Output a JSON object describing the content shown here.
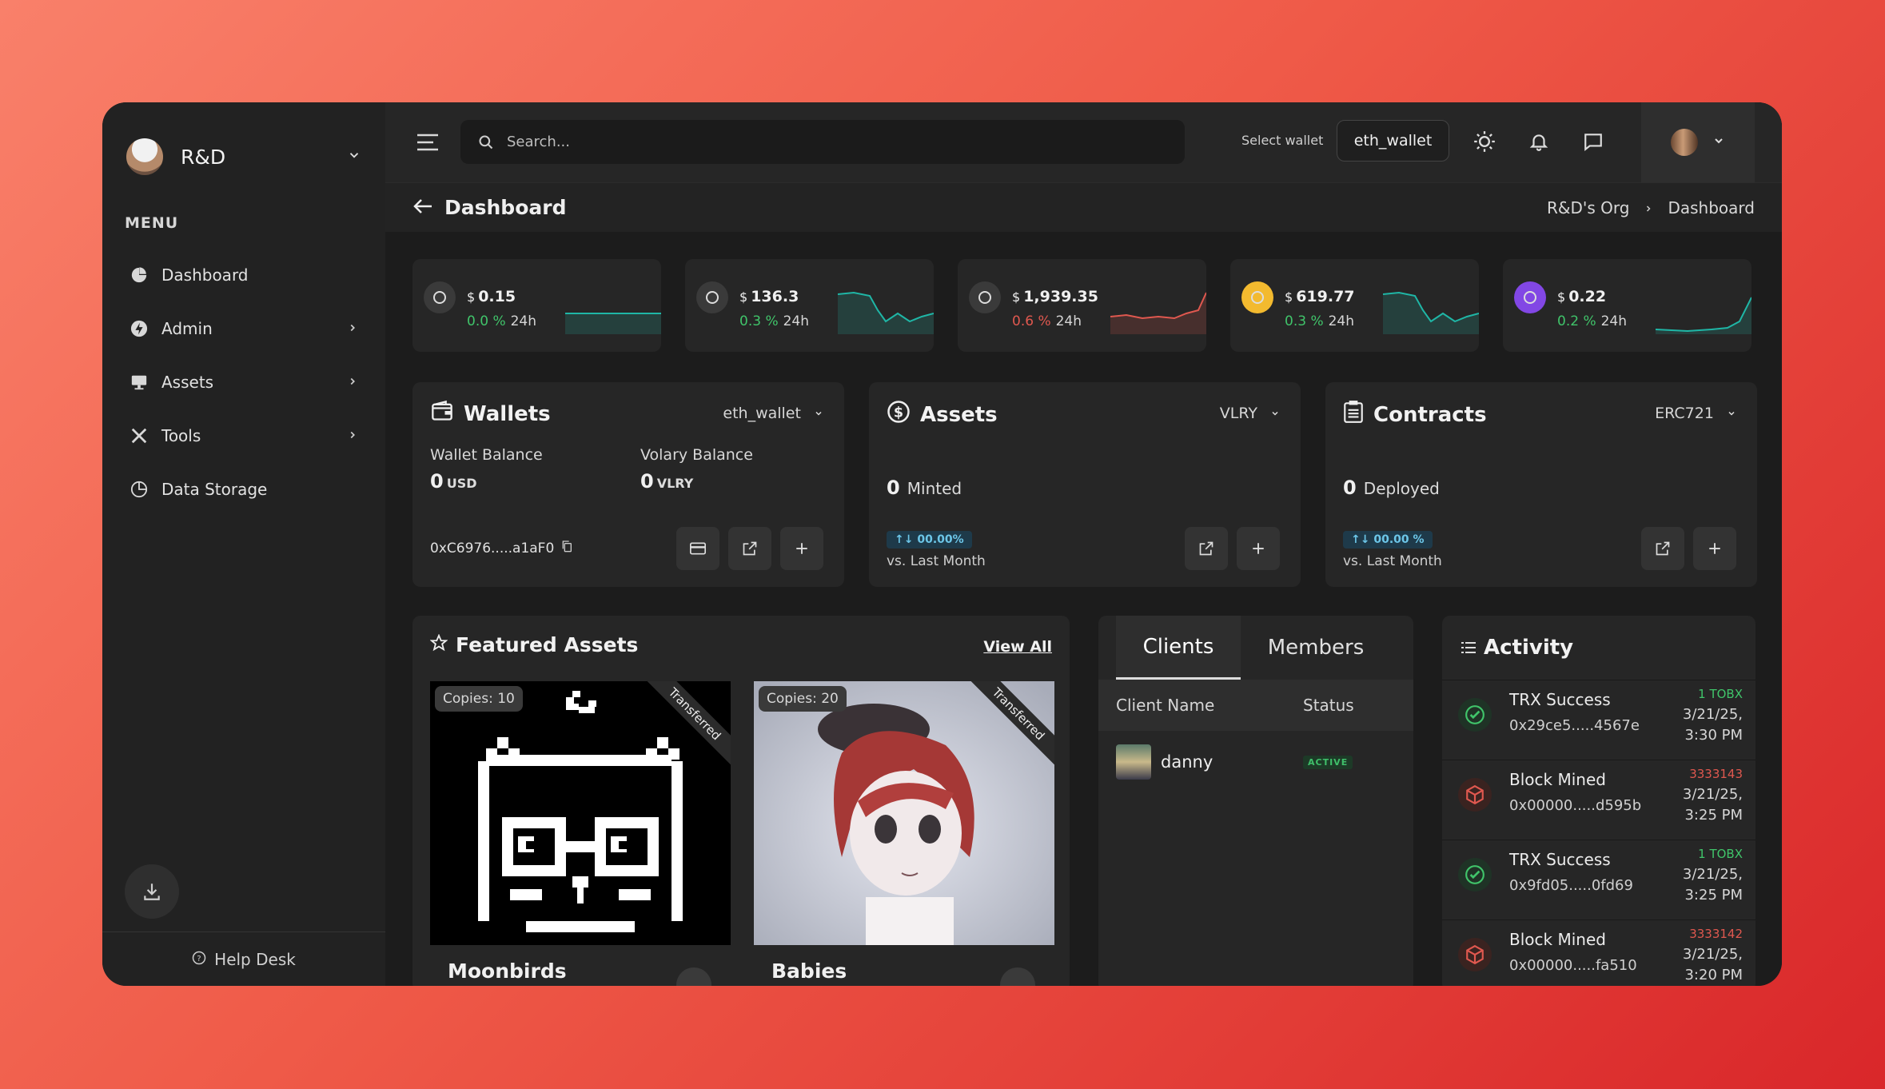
{
  "sidebar": {
    "org_name": "R&D",
    "menu_title": "MENU",
    "items": [
      {
        "label": "Dashboard",
        "icon": "pie-chart-icon",
        "has_arrow": false
      },
      {
        "label": "Admin",
        "icon": "lightning-icon",
        "has_arrow": true
      },
      {
        "label": "Assets",
        "icon": "monitor-icon",
        "has_arrow": true
      },
      {
        "label": "Tools",
        "icon": "tools-icon",
        "has_arrow": true
      },
      {
        "label": "Data Storage",
        "icon": "clock-pie-icon",
        "has_arrow": false
      }
    ],
    "help_label": "Help Desk"
  },
  "topbar": {
    "search_placeholder": "Search...",
    "select_wallet_label": "Select wallet",
    "wallet_value": "eth_wallet"
  },
  "page": {
    "title": "Dashboard",
    "breadcrumb": [
      "R&D's Org",
      "Dashboard"
    ]
  },
  "tickers": [
    {
      "price": "0.15",
      "change": "0.0 %",
      "period": "24h",
      "trend": "flat",
      "color": "#1fb6a6",
      "icon": "api3-icon"
    },
    {
      "price": "136.3",
      "change": "0.3 %",
      "period": "24h",
      "trend": "down",
      "color": "#1fb6a6",
      "icon": "solana-icon"
    },
    {
      "price": "1,939.35",
      "change": "0.6 %",
      "period": "24h",
      "trend": "up",
      "color": "#e0584f",
      "icon": "ethereum-icon"
    },
    {
      "price": "619.77",
      "change": "0.3 %",
      "period": "24h",
      "trend": "down",
      "color": "#1fb6a6",
      "icon": "bnb-icon"
    },
    {
      "price": "0.22",
      "change": "0.2 %",
      "period": "24h",
      "trend": "up",
      "color": "#1fb6a6",
      "icon": "polygon-icon"
    }
  ],
  "currency_symbol": "$",
  "wallets_card": {
    "title": "Wallets",
    "dropdown": "eth_wallet",
    "wallet_balance_label": "Wallet Balance",
    "wallet_balance_value": "0",
    "wallet_balance_unit": "USD",
    "volary_label": "Volary Balance",
    "volary_value": "0",
    "volary_unit": "VLRY",
    "address": "0xC6976.....a1aF0"
  },
  "assets_card": {
    "title": "Assets",
    "dropdown": "VLRY",
    "value": "0",
    "value_label": "Minted",
    "change": "00.00%",
    "vs_label": "vs. Last Month"
  },
  "contracts_card": {
    "title": "Contracts",
    "dropdown": "ERC721",
    "value": "0",
    "value_label": "Deployed",
    "change": "00.00 %",
    "vs_label": "vs. Last Month"
  },
  "featured": {
    "title": "Featured Assets",
    "view_all": "View All",
    "items": [
      {
        "copies": "Copies: 10",
        "ribbon": "Transferred",
        "name": "Moonbirds"
      },
      {
        "copies": "Copies: 20",
        "ribbon": "Transferred",
        "name": "Babies"
      }
    ]
  },
  "clients": {
    "tabs": [
      "Clients",
      "Members"
    ],
    "columns": [
      "Client Name",
      "Status"
    ],
    "rows": [
      {
        "name": "danny",
        "status": "ACTIVE"
      }
    ]
  },
  "activity": {
    "title": "Activity",
    "items": [
      {
        "title": "TRX Success",
        "hash": "0x29ce5.....4567e",
        "amount": "1 TOBX",
        "time": "3/21/25, 3:30 PM",
        "type": "success"
      },
      {
        "title": "Block Mined",
        "hash": "0x00000.....d595b",
        "amount": "3333143",
        "time": "3/21/25, 3:25 PM",
        "type": "block"
      },
      {
        "title": "TRX Success",
        "hash": "0x9fd05.....0fd69",
        "amount": "1 TOBX",
        "time": "3/21/25, 3:25 PM",
        "type": "success"
      },
      {
        "title": "Block Mined",
        "hash": "0x00000.....fa510",
        "amount": "3333142",
        "time": "3/21/25, 3:20 PM",
        "type": "block"
      }
    ]
  }
}
